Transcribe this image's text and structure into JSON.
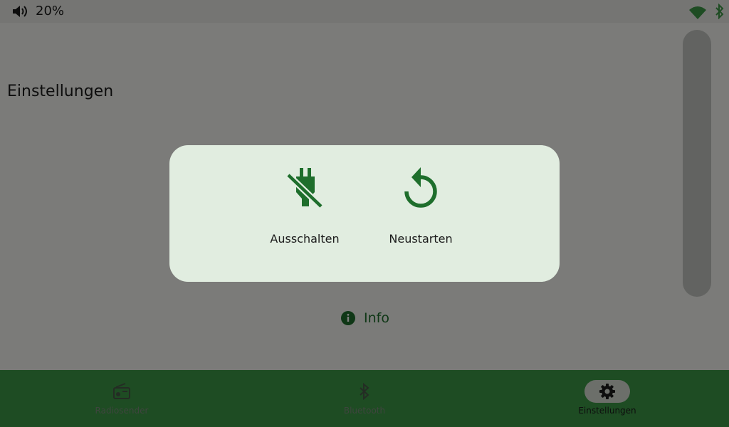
{
  "status": {
    "volume_icon": "volume-icon",
    "volume_level": "20%",
    "wifi_icon": "wifi-icon",
    "bluetooth_icon": "bluetooth-icon"
  },
  "page": {
    "title": "Einstellungen",
    "info_label": "Info"
  },
  "dialog": {
    "actions": [
      {
        "icon": "power-off-plug-icon",
        "label": "Ausschalten"
      },
      {
        "icon": "restart-icon",
        "label": "Neustarten"
      }
    ]
  },
  "nav": {
    "items": [
      {
        "icon": "radio-icon",
        "label": "Radiosender",
        "active": false
      },
      {
        "icon": "bluetooth-icon",
        "label": "Bluetooth",
        "active": false
      },
      {
        "icon": "gear-icon",
        "label": "Einstellungen",
        "active": true
      }
    ]
  },
  "colors": {
    "accent": "#1e6e2c",
    "nav_bar": "#3c9846",
    "dialog_bg": "#e1ede0",
    "scrim": "rgba(0,0,0,0.5)"
  }
}
